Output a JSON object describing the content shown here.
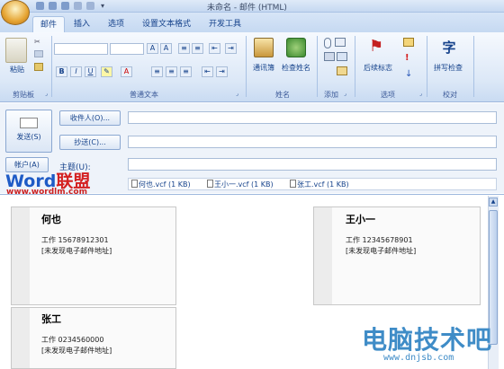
{
  "window": {
    "title": "未命名 - 邮件 (HTML)"
  },
  "tabs": [
    {
      "label": "邮件"
    },
    {
      "label": "插入"
    },
    {
      "label": "选项"
    },
    {
      "label": "设置文本格式"
    },
    {
      "label": "开发工具"
    }
  ],
  "ribbon": {
    "clipboard": {
      "paste_label": "粘贴",
      "group_label": "剪贴板"
    },
    "basic_text": {
      "group_label": "普通文本"
    },
    "names": {
      "address_book_label": "通讯簿",
      "check_names_label": "检查姓名",
      "group_label": "姓名"
    },
    "include": {
      "group_label": "添加"
    },
    "options": {
      "followup_label": "后续标志",
      "group_label": "选项"
    },
    "proofing": {
      "spellcheck_label": "拼写检查",
      "group_label": "校对"
    }
  },
  "form": {
    "send_label": "发送(S)",
    "to_label": "收件人(O)...",
    "cc_label": "抄送(C)...",
    "account_label": "帐户(A)",
    "subject_label": "主题(U):",
    "to_value": "",
    "cc_value": "",
    "subject_value": ""
  },
  "attachments": [
    {
      "name": "何也.vcf (1 KB)"
    },
    {
      "name": "王小一.vcf (1 KB)"
    },
    {
      "name": "张工.vcf (1 KB)"
    }
  ],
  "cards": [
    {
      "name": "何也",
      "phone": "工作 15678912301",
      "email": "[未发现电子邮件地址]"
    },
    {
      "name": "王小一",
      "phone": "工作 12345678901",
      "email": "[未发现电子邮件地址]"
    },
    {
      "name": "张工",
      "phone": "工作 0234560000",
      "email": "[未发现电子邮件地址]"
    }
  ],
  "watermarks": {
    "logo_word": "Word",
    "logo_cn": "联盟",
    "logo_url": "www.wordlm.com",
    "site_cn": "电脑技术吧",
    "site_url": "www.dnjsb.com"
  },
  "colors": {
    "accent": "#15428b",
    "logo_blue": "#1e5bc6",
    "logo_red": "#d42020",
    "watermark": "#3f8cc7"
  }
}
